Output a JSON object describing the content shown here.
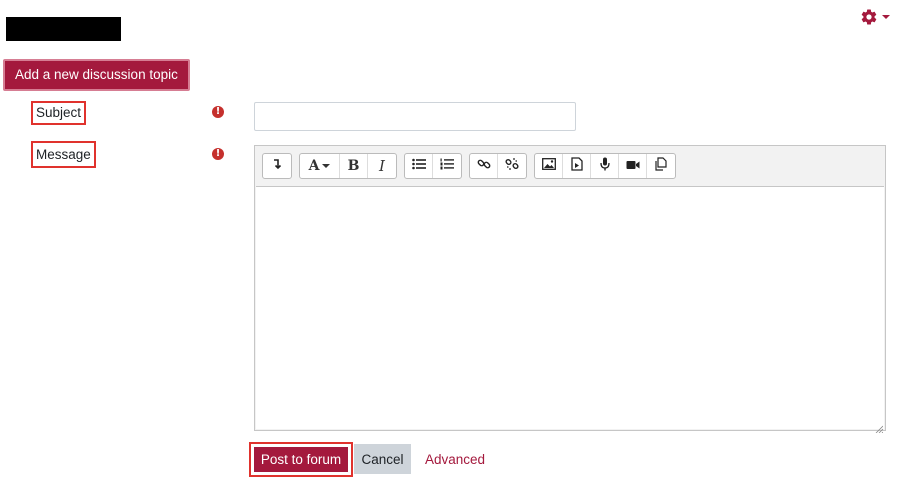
{
  "colors": {
    "brand": "#a4193d",
    "highlight_border": "#e0322d",
    "cancel_bg": "#ced4da"
  },
  "header": {
    "settings_icon": "gear-icon",
    "menu_caret_icon": "caret-down-icon"
  },
  "actions": {
    "add_topic_label": "Add a new discussion topic"
  },
  "form": {
    "subject_label": "Subject",
    "message_label": "Message",
    "required_icon": "exclamation-circle-icon",
    "subject_value": ""
  },
  "editor": {
    "toolbar_groups": [
      [
        "collapse-icon"
      ],
      [
        "font-style-icon",
        "bold-icon",
        "italic-icon"
      ],
      [
        "unordered-list-icon",
        "ordered-list-icon"
      ],
      [
        "link-icon",
        "unlink-icon"
      ],
      [
        "image-icon",
        "media-icon",
        "record-audio-icon",
        "record-video-icon",
        "manage-files-icon"
      ]
    ],
    "glyph_font_style": "A",
    "glyph_bold": "B",
    "glyph_italic": "I",
    "content": ""
  },
  "footer": {
    "post_label": "Post to forum",
    "cancel_label": "Cancel",
    "advanced_label": "Advanced"
  }
}
